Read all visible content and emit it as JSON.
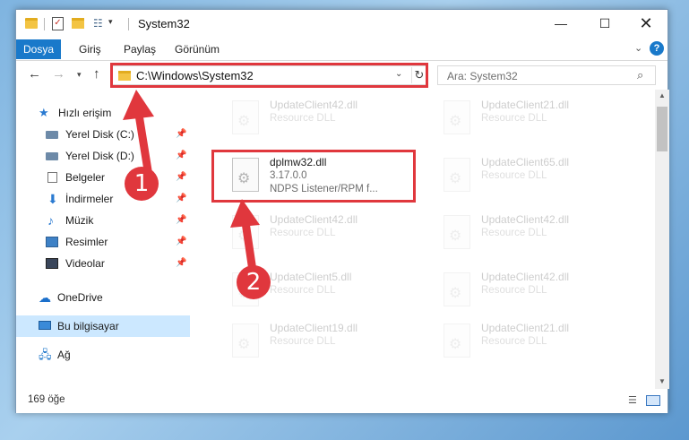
{
  "window": {
    "title": "System32",
    "controls": {
      "minimize": "—",
      "maximize": "☐",
      "close": "✕"
    }
  },
  "ribbon": {
    "tabs": [
      "Dosya",
      "Giriş",
      "Paylaş",
      "Görünüm"
    ],
    "active_tab": "Dosya",
    "accent_color": "#1979ca"
  },
  "navigation": {
    "address": "C:\\Windows\\System32",
    "search_placeholder": "Ara: System32"
  },
  "sidebar": {
    "items": [
      {
        "label": "Hızlı erişim",
        "icon": "star-icon"
      },
      {
        "label": "Yerel Disk (C:)",
        "icon": "drive-icon",
        "pinned": true
      },
      {
        "label": "Yerel Disk (D:)",
        "icon": "drive-icon",
        "pinned": true
      },
      {
        "label": "Belgeler",
        "icon": "documents-icon",
        "pinned": true
      },
      {
        "label": "İndirmeler",
        "icon": "downloads-icon",
        "pinned": true
      },
      {
        "label": "Müzik",
        "icon": "music-icon",
        "pinned": true
      },
      {
        "label": "Resimler",
        "icon": "pictures-icon",
        "pinned": true
      },
      {
        "label": "Videolar",
        "icon": "videos-icon",
        "pinned": true
      },
      {
        "label": "OneDrive",
        "icon": "onedrive-icon"
      },
      {
        "label": "Bu bilgisayar",
        "icon": "computer-icon",
        "selected": true
      },
      {
        "label": "Ağ",
        "icon": "network-icon"
      }
    ]
  },
  "files": {
    "highlighted": {
      "name": "dplmw32.dll",
      "version": "3.17.0.0",
      "description": "NDPS Listener/RPM f..."
    },
    "left_column": [
      {
        "name": "UpdateClient42.dll",
        "desc": "Resource DLL"
      },
      {
        "name": "UpdateClient42.dll",
        "desc": "Resource DLL"
      },
      {
        "name": "UpdateClient5.dll",
        "desc": "Resource DLL"
      },
      {
        "name": "UpdateClient19.dll",
        "desc": "Resource DLL"
      }
    ],
    "right_column": [
      {
        "name": "UpdateClient21.dll",
        "desc": "Resource DLL"
      },
      {
        "name": "UpdateClient65.dll",
        "desc": "Resource DLL"
      },
      {
        "name": "UpdateClient42.dll",
        "desc": "Resource DLL"
      },
      {
        "name": "UpdateClient42.dll",
        "desc": "Resource DLL"
      },
      {
        "name": "UpdateClient21.dll",
        "desc": "Resource DLL"
      }
    ]
  },
  "status": {
    "item_count": "169 öğe"
  },
  "markers": {
    "step1": "1",
    "step2": "2",
    "color": "#e0373d"
  }
}
